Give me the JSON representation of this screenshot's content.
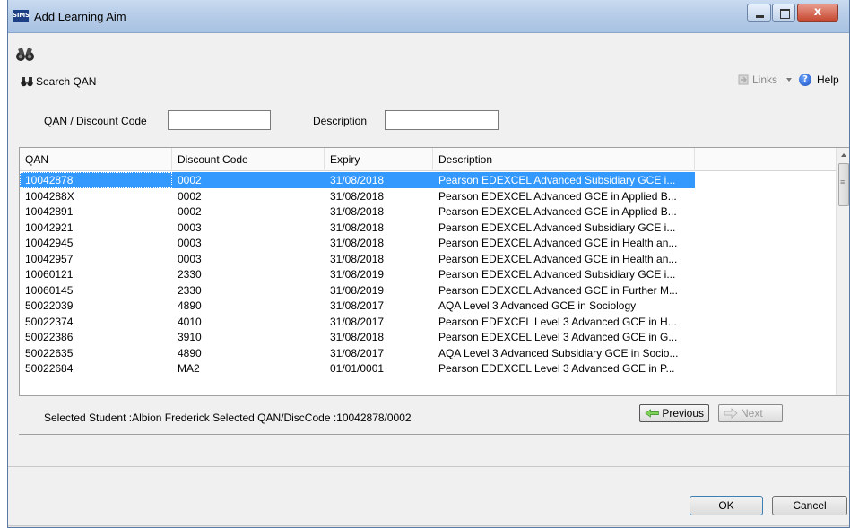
{
  "window": {
    "app_icon_text": "SIMS",
    "title": "Add Learning Aim",
    "close_glyph": "x"
  },
  "toolbar": {
    "search_label": "Search QAN",
    "links_label": "Links",
    "help_label": "Help",
    "help_glyph": "?"
  },
  "search": {
    "qan_label": "QAN / Discount Code",
    "qan_value": "",
    "description_label": "Description",
    "description_value": ""
  },
  "grid": {
    "columns": [
      "QAN",
      "Discount Code",
      "Expiry",
      "Description"
    ],
    "selected_index": 0,
    "rows": [
      {
        "qan": "10042878",
        "discount": "0002",
        "expiry": "31/08/2018",
        "description": "Pearson EDEXCEL Advanced Subsidiary GCE i..."
      },
      {
        "qan": "1004288X",
        "discount": "0002",
        "expiry": "31/08/2018",
        "description": "Pearson EDEXCEL Advanced GCE in Applied B..."
      },
      {
        "qan": "10042891",
        "discount": "0002",
        "expiry": "31/08/2018",
        "description": "Pearson EDEXCEL Advanced GCE in Applied B..."
      },
      {
        "qan": "10042921",
        "discount": "0003",
        "expiry": "31/08/2018",
        "description": "Pearson EDEXCEL Advanced Subsidiary GCE i..."
      },
      {
        "qan": "10042945",
        "discount": "0003",
        "expiry": "31/08/2018",
        "description": "Pearson EDEXCEL Advanced GCE in Health an..."
      },
      {
        "qan": "10042957",
        "discount": "0003",
        "expiry": "31/08/2018",
        "description": "Pearson EDEXCEL Advanced GCE in Health an..."
      },
      {
        "qan": "10060121",
        "discount": "2330",
        "expiry": "31/08/2019",
        "description": "Pearson EDEXCEL Advanced Subsidiary GCE i..."
      },
      {
        "qan": "10060145",
        "discount": "2330",
        "expiry": "31/08/2019",
        "description": "Pearson EDEXCEL Advanced GCE in Further M..."
      },
      {
        "qan": "50022039",
        "discount": "4890",
        "expiry": "31/08/2017",
        "description": "AQA Level 3 Advanced GCE in Sociology"
      },
      {
        "qan": "50022374",
        "discount": "4010",
        "expiry": "31/08/2017",
        "description": "Pearson EDEXCEL Level 3 Advanced GCE in H..."
      },
      {
        "qan": "50022386",
        "discount": "3910",
        "expiry": "31/08/2018",
        "description": "Pearson EDEXCEL Level 3 Advanced GCE in G..."
      },
      {
        "qan": "50022635",
        "discount": "4890",
        "expiry": "31/08/2017",
        "description": "AQA Level 3 Advanced Subsidiary GCE in Socio..."
      },
      {
        "qan": "50022684",
        "discount": "MA2",
        "expiry": "01/01/0001",
        "description": "Pearson EDEXCEL Level 3 Advanced GCE in P..."
      }
    ]
  },
  "status": {
    "selection_text": "Selected Student :Albion Frederick Selected QAN/DiscCode :10042878/0002"
  },
  "nav": {
    "previous_label": "Previous",
    "next_label": "Next"
  },
  "dialog": {
    "ok_label": "OK",
    "cancel_label": "Cancel"
  },
  "colors": {
    "selection": "#3399ff",
    "titlebar": "#b7cde8",
    "close_button": "#c74a33"
  }
}
